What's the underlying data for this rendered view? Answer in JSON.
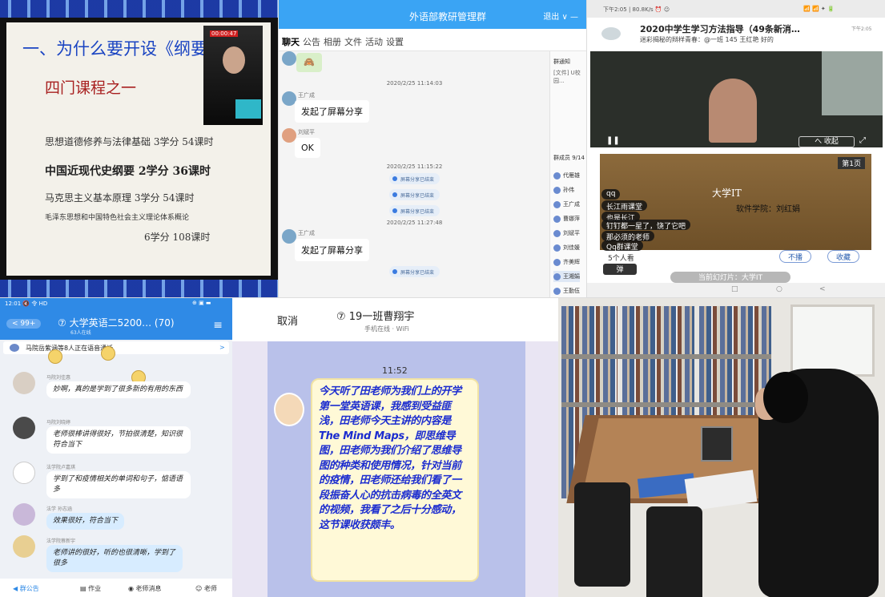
{
  "p1": {
    "title": "一、为什么要开设《纲要》课",
    "subtitle": "四门课程之一",
    "course1": "思想道德修养与法律基础  3学分  54课时",
    "course2": "中国近现代史纲要      2学分  36课时",
    "course3": "马克思主义基本原理      3学分  54课时",
    "course4a": "毛泽东思想和中国特色社会主义理论体系概论",
    "course4b": "6学分  108课时",
    "rec": "00:00:47"
  },
  "p2": {
    "title": "外语部教研管理群",
    "tabs": [
      "聊天",
      "公告",
      "相册",
      "文件",
      "活动",
      "设置"
    ],
    "window_controls": "退出 ∨ —",
    "notice_head": "群通知",
    "notice_item": "[文件] U校园...",
    "member_head": "群成员 9/14",
    "members": [
      "代雁雄",
      "孙伟",
      "王广成",
      "曹娜萍",
      "刘斌平",
      "刘佳媛",
      "齐美辉",
      "王湘娟",
      "王勤伍"
    ],
    "sticker": "🙈",
    "ts1": "2020/2/25 11:14:03",
    "name1": "王广成",
    "msg1": "发起了屏幕分享",
    "name2": "刘斌平",
    "msg2": "OK",
    "ts2": "2020/2/25 11:15:22",
    "sys": "屏幕分享已结束",
    "ts3": "2020/2/25 11:27:48",
    "name3": "王广成",
    "msg3": "发起了屏幕分享"
  },
  "p3": {
    "status_left": "下午2:05 | 80.8K/s ⏰ ☺",
    "status_right": "📶 📶 ✦ 🔋",
    "noti_title": "2020中学生学习方法指导（49条新消…",
    "noti_time": "下午2:05",
    "noti_body": "迷彩揭秘的辩样青春：@一班 145 王红艳 好的",
    "collapse": "へ 收起",
    "page": "第1页",
    "slide_title": "大学IT",
    "slide_author": "软件学院：刘红娟",
    "danmu": [
      "qq",
      "长江雨课堂",
      "也是长江",
      "钉钉都一星了，饶了它吧",
      "那必须的老师",
      "Qq群课堂"
    ],
    "label": "5个人看",
    "btn_unlike": "不播",
    "btn_fav": "收藏",
    "danmu_btn": "弹",
    "current": "当前幻灯片：大学IT",
    "nav": [
      "□",
      "○",
      "<"
    ]
  },
  "p4": {
    "status_left": "12:01 🔇 令 HD",
    "status_right": "⊕ ▣ ▬",
    "back": "< 99+",
    "title": "⑦ 大学英语二5200… (70)",
    "sub": "63人在线",
    "menu": "≡",
    "call": "马院岳紫涵等8人正在语音通话",
    "call_arrow": ">",
    "n1": "马院刘佳惠",
    "m1": "妙啊，真的是学到了很多新的有用的东西",
    "n2": "马院刘晓婷",
    "m2": "老师很棒讲得很好，节拍很清楚，知识很符合当下",
    "n3": "法学院卢嘉琪",
    "m3": "学到了和疫情相关的单词和句子，惦语语多",
    "n4": "法学 孙志涵",
    "m4": "效果很好，符合当下",
    "n5": "法学院蔡新宇",
    "m5": "老师讲的很好，听的也很清晰，学到了很多",
    "foot": [
      "◀ 群公告",
      "▤ 作业",
      "◉ 老师消息",
      "☺ 老师"
    ]
  },
  "p5": {
    "cancel": "取消",
    "name": "⑦ 19一班曹翔宇",
    "online": "手机在线 · WiFi",
    "time": "11:52",
    "message": "今天听了田老师为我们上的开学第一堂英语课，我感到受益匪浅，田老师今天主讲的内容是The Mind Maps，即思维导图，田老师为我们介绍了思维导图的种类和使用情况，针对当前的疫情，田老师还给我们看了一段振奋人心的抗击病毒的全英文的视频，我看了之后十分感动，这节课收获颇丰。"
  }
}
